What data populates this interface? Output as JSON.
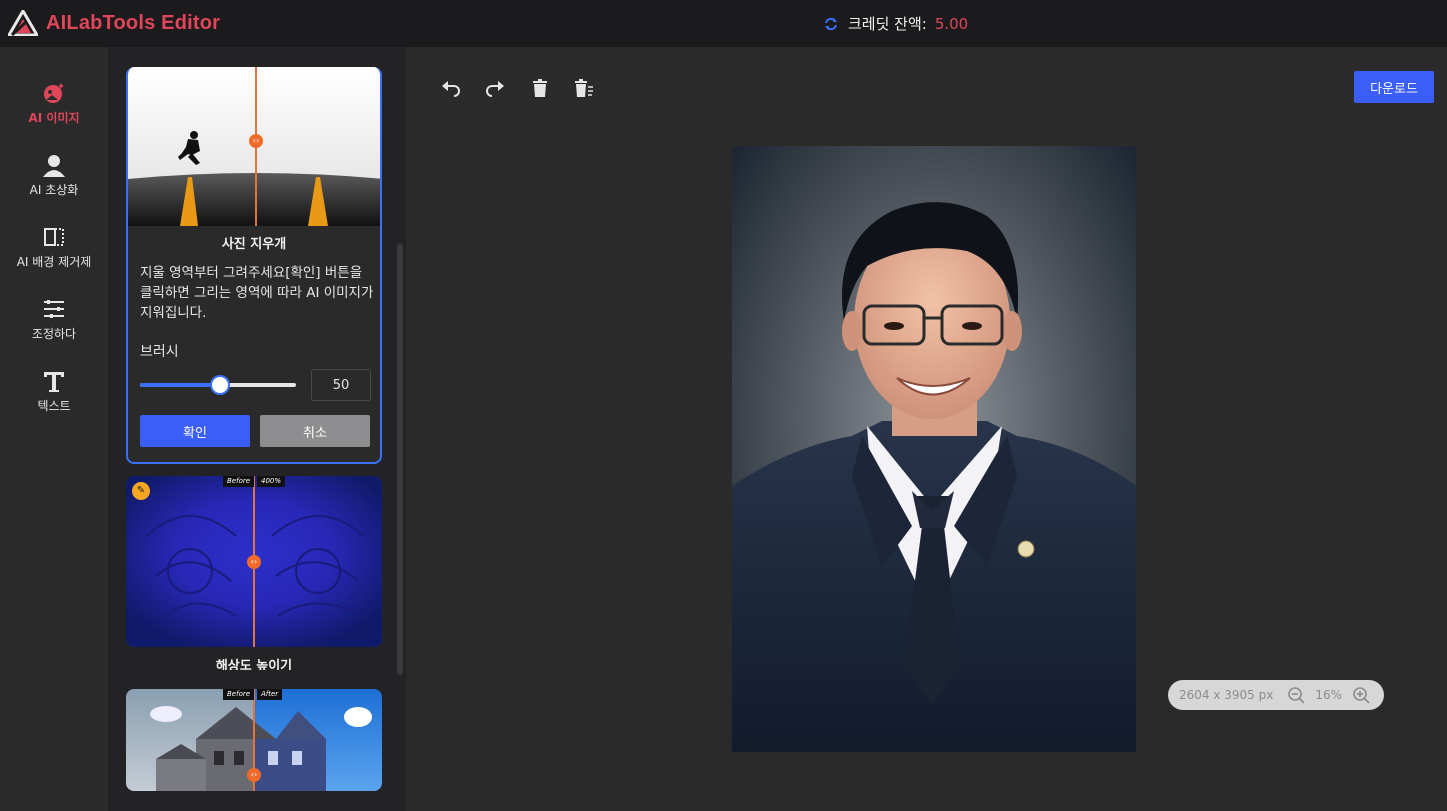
{
  "app": {
    "title": "AILabTools Editor"
  },
  "credit": {
    "label": "크레딧 잔액:",
    "value": "5.00"
  },
  "rail": {
    "items": [
      {
        "label": "AI 이미지",
        "icon": "ai-image-icon",
        "active": true
      },
      {
        "label": "AI 초상화",
        "icon": "portrait-icon",
        "active": false
      },
      {
        "label": "AI 배경 제거제",
        "icon": "background-remove-icon",
        "active": false
      },
      {
        "label": "조정하다",
        "icon": "sliders-icon",
        "active": false
      },
      {
        "label": "텍스트",
        "icon": "text-icon",
        "active": false
      }
    ]
  },
  "eraser": {
    "title": "사진 지우개",
    "description": "지울 영역부터 그려주세요[확인] 버튼을 클릭하면 그리는 영역에 따라 AI 이미지가 지워집니다.",
    "brush_label": "브러시",
    "brush_value": "50",
    "brush_fraction": 0.5,
    "confirm_label": "확인",
    "cancel_label": "취소"
  },
  "upscale": {
    "title": "해상도 높이기",
    "tag_before": "Before",
    "tag_after": "400%"
  },
  "house": {
    "tag_before": "Before",
    "tag_after": "After"
  },
  "toolbar": {
    "undo_icon": "undo-icon",
    "redo_icon": "redo-icon",
    "delete_icon": "trash-icon",
    "clear_icon": "clear-all-icon",
    "download_label": "다운로드"
  },
  "zoom": {
    "dimensions": "2604 x 3905 px",
    "percent": "16%"
  },
  "colors": {
    "accent": "#3a5ef7",
    "brand": "#e0455a",
    "divider": "#f06b2a"
  }
}
